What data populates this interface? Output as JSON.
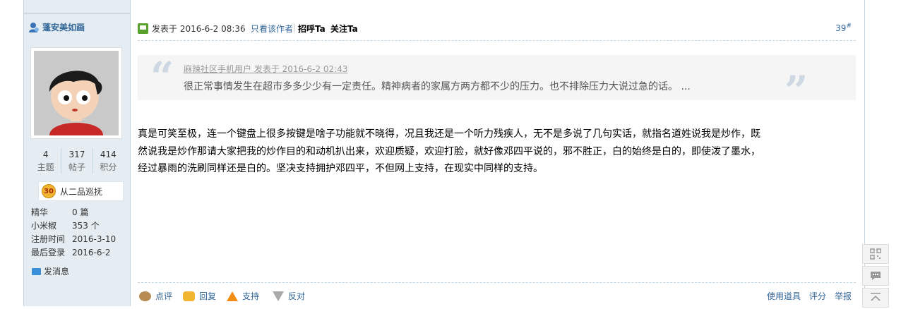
{
  "ghost_row": {
    "items": [
      "点评",
      "回复",
      "支持",
      "反对"
    ],
    "right": [
      "使用道具",
      "举报"
    ]
  },
  "user": {
    "name": "蓬安美如画",
    "stats": [
      {
        "value": "4",
        "label": "主题"
      },
      {
        "value": "317",
        "label": "帖子"
      },
      {
        "value": "414",
        "label": "积分"
      }
    ],
    "medal": {
      "level": "30",
      "label": "从二品巡抚"
    },
    "info": [
      {
        "key": "精华",
        "value": "0 篇"
      },
      {
        "key": "小米椒",
        "value": "353 个"
      },
      {
        "key": "注册时间",
        "value": "2016-3-10"
      },
      {
        "key": "最后登录",
        "value": "2016-6-2"
      }
    ],
    "send_message": "发消息"
  },
  "post": {
    "posted_at": "发表于 2016-6-2 08:36",
    "only_author": "只看该作者",
    "greet": "招呼Ta",
    "follow": "关注Ta",
    "floor": "39",
    "floor_mark": "#",
    "quote": {
      "source": "麻辣社区手机用户 发表于 2016-6-2 02:43",
      "text": "很正常事情发生在超市多多少少有一定责任。精神病者的家属方两方都不少的压力。也不排除压力大说过急的话。 ..."
    },
    "body_lines": [
      "真是可笑至极，连一个键盘上很多按键是啥子功能就不晓得，况且我还是一个听力残疾人，无不是多说了几句实话，就指名道姓说我是炒作，既",
      "然说我是炒作那请大家把我的炒作目的和动机扒出来，欢迎质疑，欢迎打脸，就好像邓四平说的，邪不胜正，白的始终是白的，即使泼了墨水，",
      "经过暴雨的洗刷同样还是白的。坚决支持拥护邓四平，不但网上支持，在现实中同样的支持。"
    ]
  },
  "actions": {
    "review": "点评",
    "reply": "回复",
    "support": "支持",
    "oppose": "反对",
    "use_tool": "使用道具",
    "rate": "评分",
    "report": "举报"
  },
  "colors": {
    "link": "#336699",
    "sidebar_bg": "#e5edf2",
    "border": "#c2d5e3"
  }
}
